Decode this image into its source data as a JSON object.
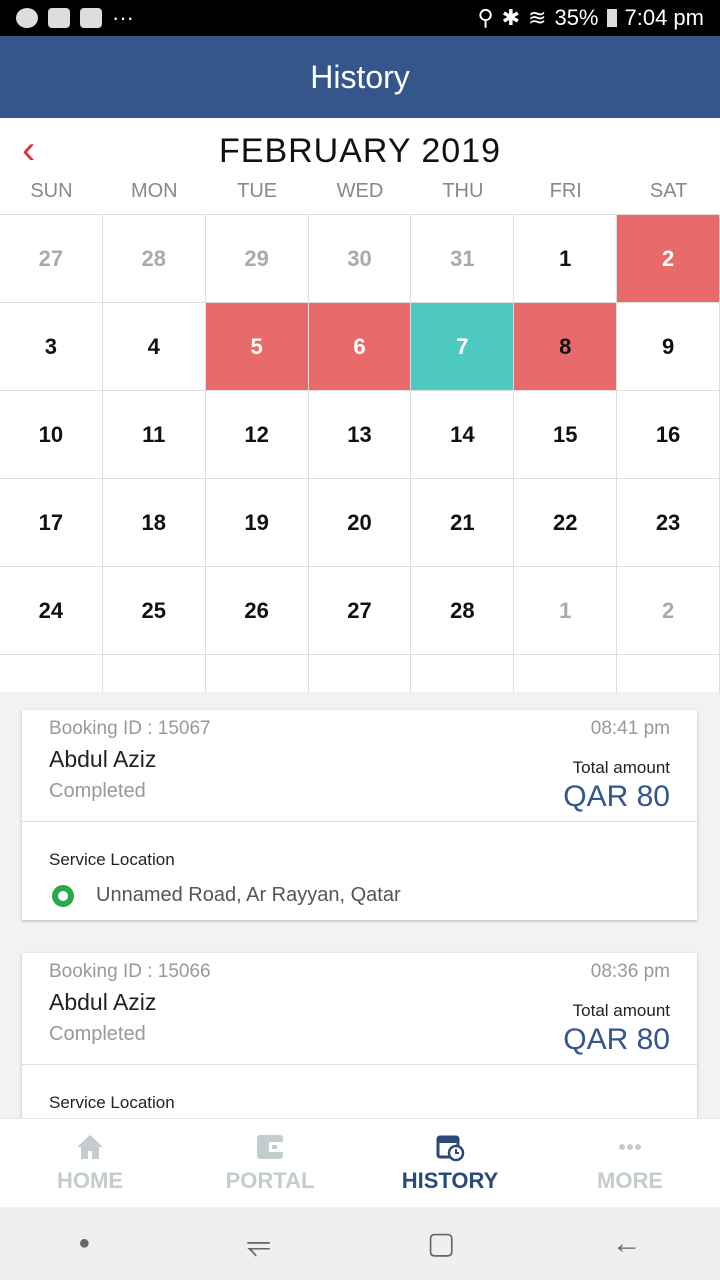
{
  "status_bar": {
    "battery": "35%",
    "time": "7:04 pm"
  },
  "header": {
    "title": "History"
  },
  "calendar": {
    "month_title": "FEBRUARY 2019",
    "weekdays": [
      "SUN",
      "MON",
      "TUE",
      "WED",
      "THU",
      "FRI",
      "SAT"
    ],
    "colors": {
      "booked": "#e86a6a",
      "today": "#4ec9c0"
    },
    "weeks": [
      [
        {
          "d": "27",
          "s": "muted"
        },
        {
          "d": "28",
          "s": "muted"
        },
        {
          "d": "29",
          "s": "muted"
        },
        {
          "d": "30",
          "s": "muted"
        },
        {
          "d": "31",
          "s": "muted"
        },
        {
          "d": "1"
        },
        {
          "d": "2",
          "s": "red"
        }
      ],
      [
        {
          "d": "3"
        },
        {
          "d": "4"
        },
        {
          "d": "5",
          "s": "red"
        },
        {
          "d": "6",
          "s": "red"
        },
        {
          "d": "7",
          "s": "teal"
        },
        {
          "d": "8",
          "s": "red dark"
        },
        {
          "d": "9"
        }
      ],
      [
        {
          "d": "10"
        },
        {
          "d": "11"
        },
        {
          "d": "12"
        },
        {
          "d": "13"
        },
        {
          "d": "14"
        },
        {
          "d": "15"
        },
        {
          "d": "16"
        }
      ],
      [
        {
          "d": "17"
        },
        {
          "d": "18"
        },
        {
          "d": "19"
        },
        {
          "d": "20"
        },
        {
          "d": "21"
        },
        {
          "d": "22"
        },
        {
          "d": "23"
        }
      ],
      [
        {
          "d": "24"
        },
        {
          "d": "25"
        },
        {
          "d": "26"
        },
        {
          "d": "27"
        },
        {
          "d": "28"
        },
        {
          "d": "1",
          "s": "muted"
        },
        {
          "d": "2",
          "s": "muted"
        }
      ]
    ]
  },
  "bookings": [
    {
      "id": "Booking ID : 15067",
      "time": "08:41 pm",
      "name": "Abdul Aziz",
      "status": "Completed",
      "total_label": "Total amount",
      "amount": "QAR 80",
      "location_label": "Service Location",
      "location": "Unnamed Road, Ar Rayyan, Qatar"
    },
    {
      "id": "Booking ID : 15066",
      "time": "08:36 pm",
      "name": "Abdul Aziz",
      "status": "Completed",
      "total_label": "Total amount",
      "amount": "QAR 80",
      "location_label": "Service Location"
    }
  ],
  "nav": {
    "items": [
      {
        "label": "HOME",
        "icon": "home-icon"
      },
      {
        "label": "PORTAL",
        "icon": "wallet-icon"
      },
      {
        "label": "HISTORY",
        "icon": "calendar-clock-icon",
        "active": true
      },
      {
        "label": "MORE",
        "icon": "more-icon"
      }
    ]
  }
}
